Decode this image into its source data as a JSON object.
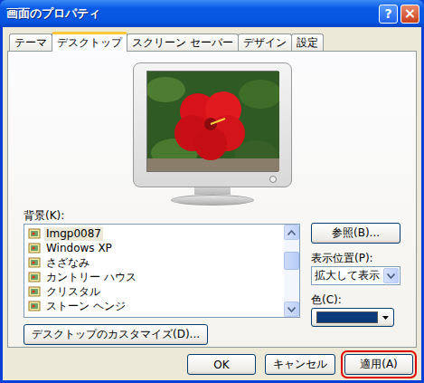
{
  "window": {
    "title": "画面のプロパティ",
    "help_button": "?",
    "close_button": "×"
  },
  "tabs": [
    {
      "label": "テーマ",
      "selected": false
    },
    {
      "label": "デスクトップ",
      "selected": true
    },
    {
      "label": "スクリーン セーバー",
      "selected": false
    },
    {
      "label": "デザイン",
      "selected": false
    },
    {
      "label": "設定",
      "selected": false
    }
  ],
  "background": {
    "label": "背景(K):",
    "items": [
      {
        "name": "Imgp0087",
        "selected": true
      },
      {
        "name": "Windows XP",
        "selected": false
      },
      {
        "name": "さざなみ",
        "selected": false
      },
      {
        "name": "カントリー ハウス",
        "selected": false
      },
      {
        "name": "クリスタル",
        "selected": false
      },
      {
        "name": "ストーン ヘンジ",
        "selected": false
      }
    ],
    "scrollbar": {
      "level": 0.28
    }
  },
  "browse_button": "参照(B)...",
  "position": {
    "label": "表示位置(P):",
    "value": "拡大して表示"
  },
  "color": {
    "label": "色(C):",
    "value": "#0b3a7c"
  },
  "customize_button": "デスクトップのカスタマイズ(D)...",
  "buttons": [
    {
      "label": "OK",
      "highlighted": false
    },
    {
      "label": "キャンセル",
      "highlighted": false
    },
    {
      "label": "適用(A)",
      "highlighted": true
    }
  ]
}
